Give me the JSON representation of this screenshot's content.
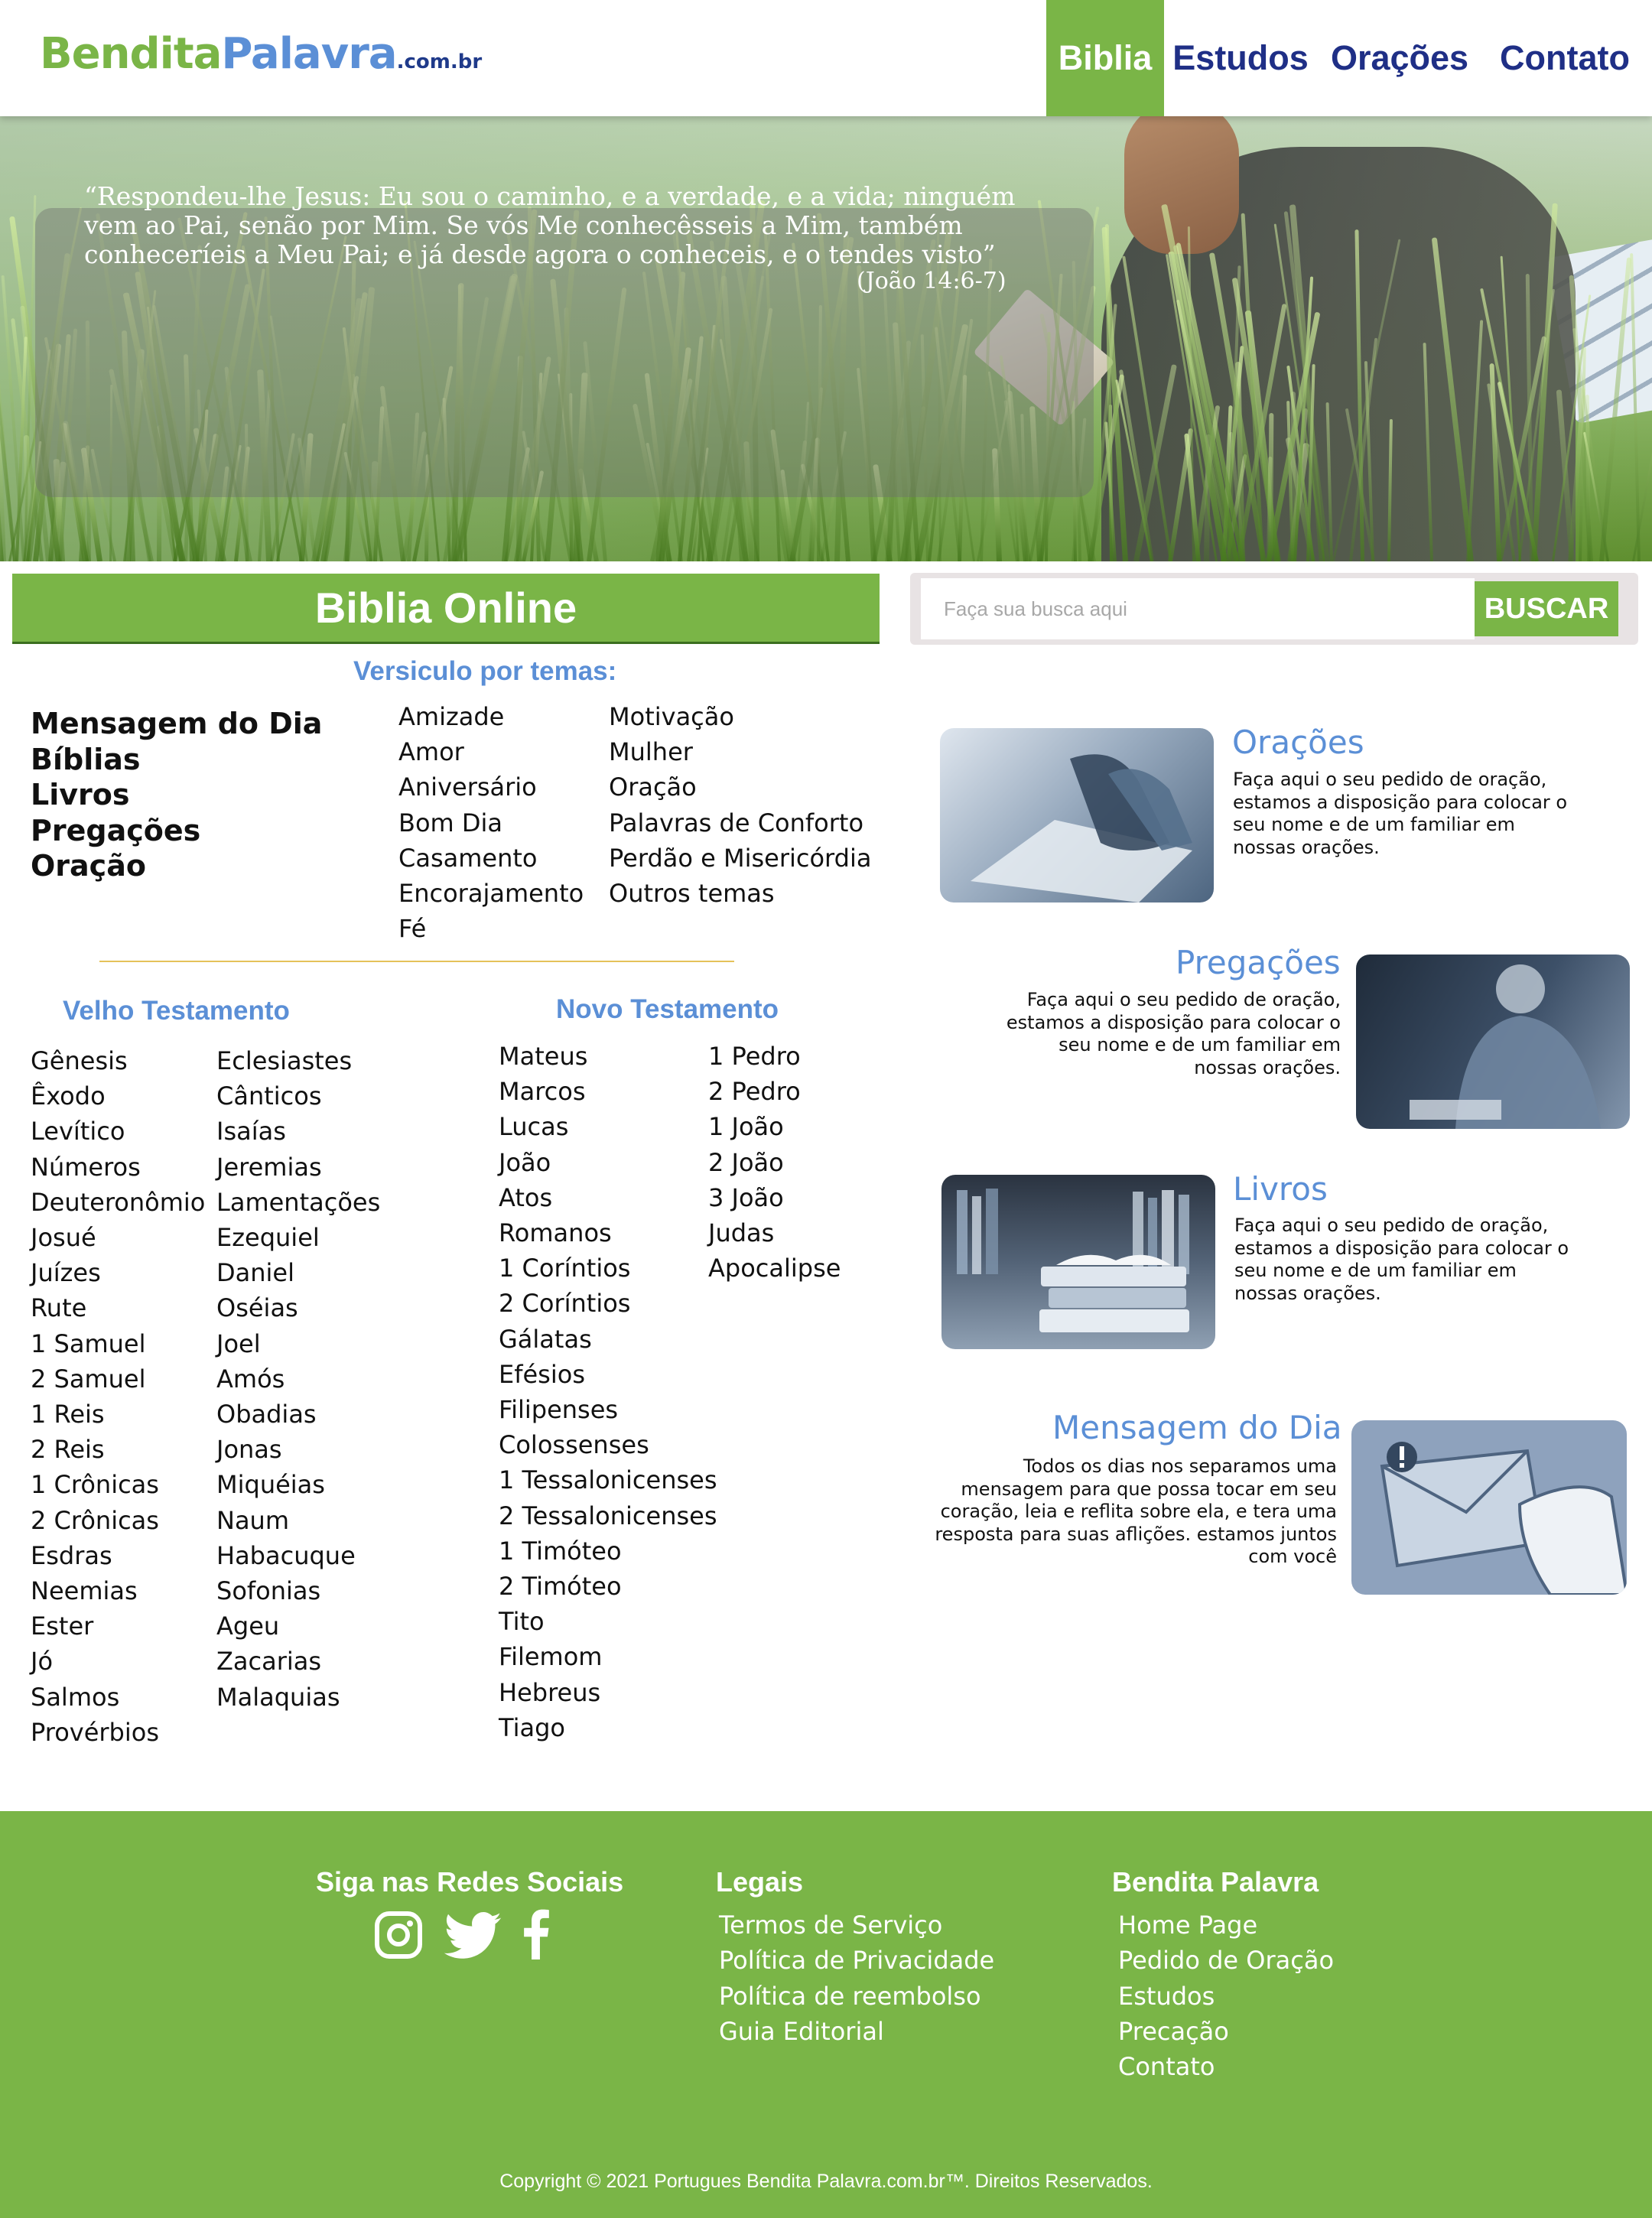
{
  "header": {
    "logo": {
      "part1": "Bendita",
      "part2": "Palavra",
      "part3": ".com.br"
    },
    "nav": [
      {
        "label": "Biblia",
        "active": true
      },
      {
        "label": "Estudos",
        "active": false
      },
      {
        "label": "Orações",
        "active": false
      },
      {
        "label": "Contato",
        "active": false
      }
    ]
  },
  "hero": {
    "quote": "“Respondeu-lhe Jesus: Eu sou o caminho, e a verdade, e a vida; ninguém vem ao Pai, senão por Mim. Se vós Me conhecêsseis a Mim, também conheceríeis a Meu Pai; e já desde agora o conheceis, e o tendes visto”",
    "reference": "(João 14:6-7)"
  },
  "biblia_online": {
    "title": "Biblia Online",
    "temas_heading": "Versiculo por temas:",
    "main_links": [
      "Mensagem do Dia",
      "Bíblias",
      "Livros",
      "Pregações",
      "Oração"
    ],
    "temas_col1": [
      "Amizade",
      "Amor",
      "Aniversário",
      "Bom Dia",
      "Casamento",
      "Encorajamento",
      "Fé"
    ],
    "temas_col2": [
      "Motivação",
      "Mulher",
      "Oração",
      "Palavras de Conforto",
      "Perdão e Misericórdia",
      "Outros temas"
    ]
  },
  "search": {
    "placeholder": "Faça sua busca aqui",
    "button": "BUSCAR"
  },
  "velho_testamento": {
    "heading": "Velho Testamento",
    "col1": [
      "Gênesis",
      "Êxodo",
      "Levítico",
      "Números",
      "Deuteronômio",
      "Josué",
      "Juízes",
      "Rute",
      "1 Samuel",
      "2 Samuel",
      "1 Reis",
      "2 Reis",
      "1 Crônicas",
      "2 Crônicas",
      "Esdras",
      "Neemias",
      "Ester",
      "Jó",
      "Salmos",
      "Provérbios"
    ],
    "col2": [
      "Eclesiastes",
      "Cânticos",
      "Isaías",
      "Jeremias",
      "Lamentações",
      "Ezequiel",
      "Daniel",
      "Oséias",
      "Joel",
      "Amós",
      "Obadias",
      "Jonas",
      "Miquéias",
      "Naum",
      "Habacuque",
      "Sofonias",
      "Ageu",
      "Zacarias",
      "Malaquias"
    ]
  },
  "novo_testamento": {
    "heading": "Novo Testamento",
    "col1": [
      "Mateus",
      "Marcos",
      "Lucas",
      "João",
      "Atos",
      "Romanos",
      "1 Coríntios",
      "2 Coríntios",
      "Gálatas",
      "Efésios",
      "Filipenses",
      "Colossenses",
      "1 Tessalonicenses",
      "2 Tessalonicenses",
      "1 Timóteo",
      "2 Timóteo",
      "Tito",
      "Filemom",
      "Hebreus",
      "Tiago"
    ],
    "col2": [
      "1 Pedro",
      "2 Pedro",
      "1 João",
      "2 João",
      "3 João",
      "Judas",
      "Apocalipse"
    ]
  },
  "cards": [
    {
      "title": "Orações",
      "desc": "Faça aqui o seu pedido de oração, estamos a disposição para colocar o seu nome e de um familiar em nossas orações."
    },
    {
      "title": "Pregações",
      "desc": "Faça aqui o seu pedido de oração, estamos a disposição para colocar o seu nome e de um familiar em nossas orações."
    },
    {
      "title": "Livros",
      "desc": "Faça aqui o seu pedido de oração, estamos a disposição para colocar o seu nome e de um familiar em nossas orações."
    },
    {
      "title": "Mensagem do Dia",
      "desc": "Todos os dias nos separamos uma mensagem para que possa tocar em seu coração, leia e reflita sobre ela, e tera uma resposta para suas aflições. estamos juntos com você"
    }
  ],
  "footer": {
    "social_heading": "Siga nas Redes Sociais",
    "social_icons": [
      "instagram-icon",
      "twitter-icon",
      "facebook-icon"
    ],
    "legais_heading": "Legais",
    "legais": [
      "Termos de Serviço",
      "Política de Privacidade",
      "Política de reembolso",
      "Guia Editorial"
    ],
    "bp_heading": "Bendita Palavra",
    "bp_links": [
      "Home Page",
      "Pedido de Oração",
      "Estudos",
      "Precação",
      "Contato"
    ],
    "copyright": "Copyright © 2021 Portugues Bendita Palavra.com.br™. Direitos Reservados."
  },
  "colors": {
    "brand_green": "#7ab547",
    "accent_blue": "#5b8fd6",
    "nav_navy": "#1f2f86"
  }
}
